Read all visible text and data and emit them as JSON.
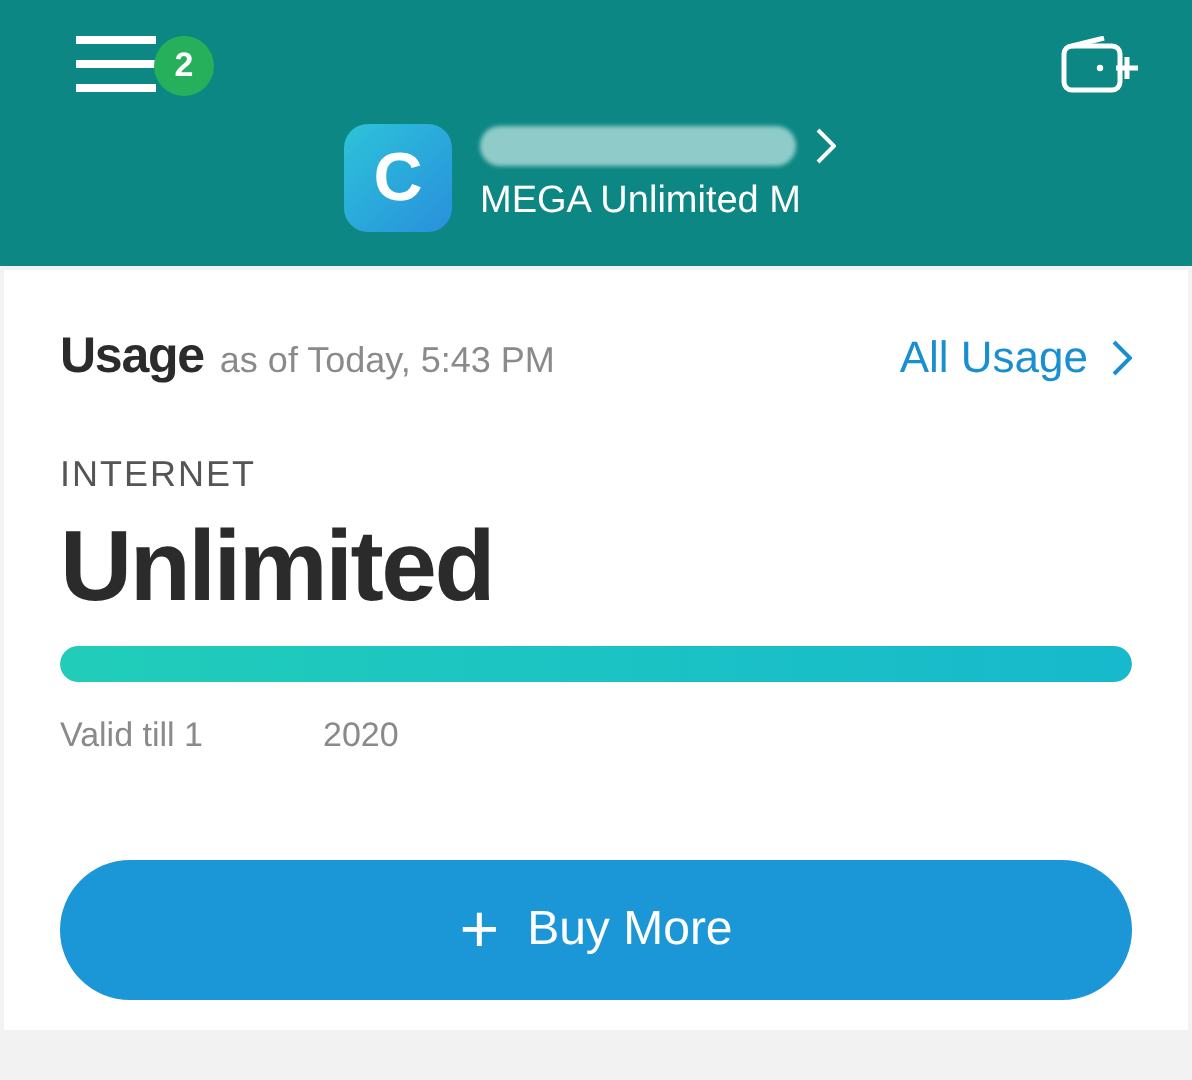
{
  "header": {
    "menu_badge": "2",
    "account_initial": "C",
    "plan_name": "MEGA Unlimited M"
  },
  "usage": {
    "title": "Usage",
    "as_of": "as of Today, 5:43 PM",
    "all_usage_link": "All Usage",
    "category": "INTERNET",
    "amount": "Unlimited",
    "level": 1,
    "valid_label": "Valid till 1",
    "valid_year": "2020"
  },
  "buy_button": {
    "icon": "+",
    "label": "Buy More"
  }
}
